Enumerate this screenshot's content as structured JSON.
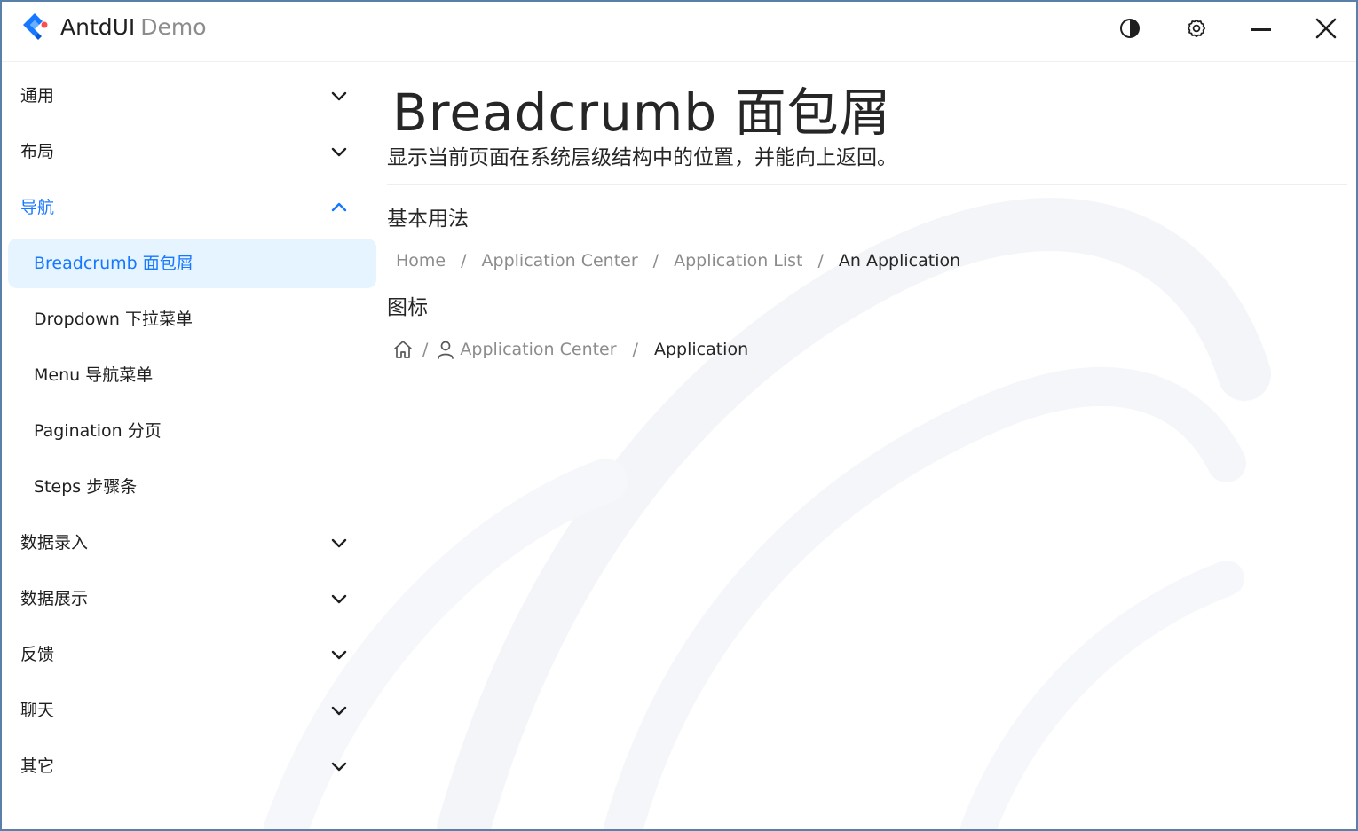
{
  "colors": {
    "accent": "#1677ff",
    "active_bg": "#e6f4ff",
    "text": "#1f1f1f",
    "muted": "#8c8c8c"
  },
  "app": {
    "name": "AntdUI",
    "suffix": "Demo",
    "logo_icon": "antd-diamond-logo-icon"
  },
  "titlebar": {
    "icons": [
      "theme-toggle-icon",
      "settings-icon",
      "minimize-icon",
      "close-icon"
    ]
  },
  "sidebar": {
    "groups": [
      {
        "label": "通用",
        "expanded": false
      },
      {
        "label": "布局",
        "expanded": false
      },
      {
        "label": "导航",
        "expanded": true,
        "items": [
          {
            "label": "Breadcrumb 面包屑",
            "active": true
          },
          {
            "label": "Dropdown 下拉菜单"
          },
          {
            "label": "Menu 导航菜单"
          },
          {
            "label": "Pagination 分页"
          },
          {
            "label": "Steps 步骤条"
          }
        ]
      },
      {
        "label": "数据录入",
        "expanded": false
      },
      {
        "label": "数据展示",
        "expanded": false
      },
      {
        "label": "反馈",
        "expanded": false
      },
      {
        "label": "聊天",
        "expanded": false
      },
      {
        "label": "其它",
        "expanded": false
      }
    ]
  },
  "main": {
    "title": "Breadcrumb 面包屑",
    "description": "显示当前页面在系统层级结构中的位置，并能向上返回。",
    "sections": [
      {
        "title": "基本用法",
        "crumbs": [
          "Home",
          "Application Center",
          "Application List",
          "An Application"
        ],
        "separator": "/"
      },
      {
        "title": "图标",
        "crumbs": [
          "",
          "Application Center",
          "Application"
        ],
        "crumb_icons": [
          "home-icon",
          "user-icon",
          ""
        ],
        "separator": "/"
      }
    ]
  }
}
